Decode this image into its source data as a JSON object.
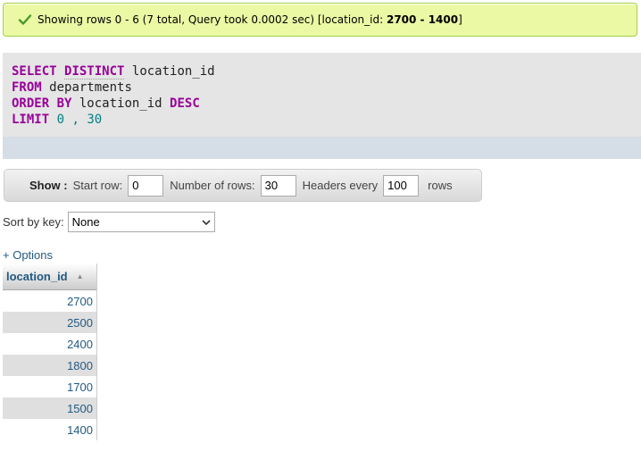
{
  "banner": {
    "msg_prefix": "Showing rows 0 - 6 (7 total, Query took 0.0002 sec) [location_id: ",
    "range_bold": "2700 - 1400",
    "msg_suffix": "]"
  },
  "sql": {
    "kw_select": "SELECT",
    "kw_distinct": "DISTINCT",
    "col": "location_id",
    "kw_from": "FROM",
    "table": "departments",
    "kw_order": "ORDER BY",
    "order_col": "location_id",
    "kw_desc": "DESC",
    "kw_limit": "LIMIT",
    "limit_start": "0",
    "limit_sep": " , ",
    "limit_count": "30"
  },
  "show": {
    "label": "Show :",
    "start_row_label": "Start row:",
    "start_row_value": "0",
    "num_rows_label": "Number of rows:",
    "num_rows_value": "30",
    "headers_label": "Headers every",
    "headers_value": "100",
    "rows_word": "rows"
  },
  "sort": {
    "label": "Sort by key:",
    "selected": "None"
  },
  "options_link": "+ Options",
  "table": {
    "header": "location_id",
    "rows": [
      "2700",
      "2500",
      "2400",
      "1800",
      "1700",
      "1500",
      "1400"
    ]
  },
  "colors": {
    "success_bg": "#ebf8a4",
    "keyword": "#990099",
    "number": "#008080",
    "link": "#235a81"
  }
}
